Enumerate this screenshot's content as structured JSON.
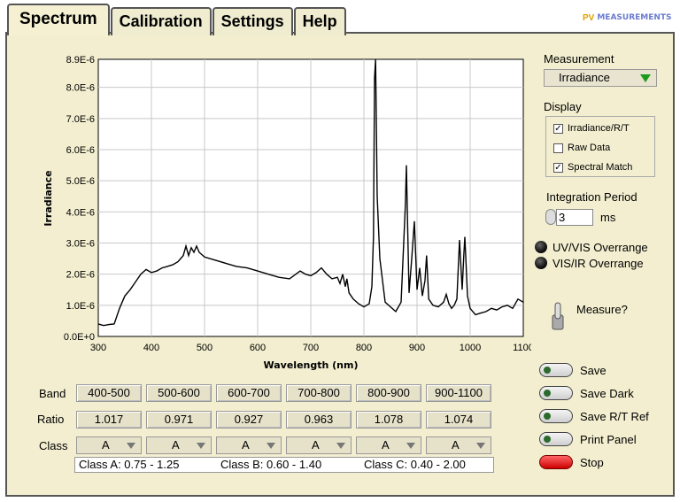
{
  "tabs": [
    {
      "label": "Spectrum",
      "active": true
    },
    {
      "label": "Calibration",
      "active": false
    },
    {
      "label": "Settings",
      "active": false
    },
    {
      "label": "Help",
      "active": false
    }
  ],
  "logo": {
    "mark": "PV",
    "text": "MEASUREMENTS"
  },
  "measurement": {
    "title": "Measurement",
    "selected": "Irradiance"
  },
  "display": {
    "title": "Display",
    "options": [
      {
        "label": "Irradiance/R/T",
        "checked": true
      },
      {
        "label": "Raw Data",
        "checked": false
      },
      {
        "label": "Spectral Match",
        "checked": true
      }
    ]
  },
  "integration": {
    "title": "Integration Period",
    "value": "3",
    "unit": "ms"
  },
  "indicators": {
    "uv_vis": "UV/VIS Overrange",
    "vis_ir": "VIS/IR Overrange"
  },
  "measure_toggle": {
    "label": "Measure?"
  },
  "buttons": {
    "save": "Save",
    "save_dark": "Save Dark",
    "save_rt_ref": "Save R/T Ref",
    "print_panel": "Print Panel",
    "stop": "Stop"
  },
  "table": {
    "band_label": "Band",
    "ratio_label": "Ratio",
    "class_label": "Class",
    "bands": [
      "400-500",
      "500-600",
      "600-700",
      "700-800",
      "800-900",
      "900-1100"
    ],
    "ratios": [
      "1.017",
      "0.971",
      "0.927",
      "0.963",
      "1.078",
      "1.074"
    ],
    "classes": [
      "A",
      "A",
      "A",
      "A",
      "A",
      "A"
    ],
    "legend": {
      "a": "Class A:  0.75 - 1.25",
      "b": "Class B:  0.60 - 1.40",
      "c": "Class C:  0.40 - 2.00"
    }
  },
  "chart_data": {
    "type": "line",
    "xlabel": "Wavelength (nm)",
    "ylabel": "Irradiance",
    "xlim": [
      300,
      1100
    ],
    "ylim": [
      0,
      8.9e-06
    ],
    "xticks": [
      "300",
      "400",
      "500",
      "600",
      "700",
      "800",
      "900",
      "1000",
      "1100"
    ],
    "yticks": [
      "0.0E+0",
      "1.0E-6",
      "2.0E-6",
      "3.0E-6",
      "4.0E-6",
      "5.0E-6",
      "6.0E-6",
      "7.0E-6",
      "8.0E-6",
      "8.9E-6"
    ],
    "grid": true,
    "color": "#000000",
    "series": [
      {
        "x": [
          300,
          310,
          320,
          330,
          340,
          350,
          360,
          370,
          380,
          390,
          400,
          410,
          420,
          430,
          440,
          450,
          460,
          465,
          470,
          475,
          480,
          485,
          490,
          500,
          520,
          540,
          560,
          580,
          600,
          620,
          640,
          660,
          680,
          690,
          700,
          710,
          720,
          730,
          740,
          750,
          755,
          760,
          765,
          768,
          772,
          780,
          790,
          800,
          810,
          815,
          818,
          820,
          822,
          825,
          830,
          835,
          840,
          850,
          860,
          870,
          878,
          880,
          882,
          885,
          890,
          895,
          900,
          905,
          910,
          915,
          918,
          922,
          930,
          940,
          950,
          955,
          960,
          965,
          970,
          975,
          980,
          985,
          988,
          990,
          995,
          1000,
          1005,
          1010,
          1020,
          1030,
          1040,
          1050,
          1060,
          1070,
          1080,
          1090,
          1100
        ],
        "y": [
          4e-07,
          3.5e-07,
          3.8e-07,
          4e-07,
          9e-07,
          1.3e-06,
          1.5e-06,
          1.75e-06,
          2e-06,
          2.15e-06,
          2.05e-06,
          2.1e-06,
          2.2e-06,
          2.25e-06,
          2.3e-06,
          2.4e-06,
          2.6e-06,
          2.9e-06,
          2.6e-06,
          2.85e-06,
          2.7e-06,
          2.9e-06,
          2.7e-06,
          2.55e-06,
          2.45e-06,
          2.35e-06,
          2.25e-06,
          2.2e-06,
          2.1e-06,
          2e-06,
          1.9e-06,
          1.85e-06,
          2.1e-06,
          2e-06,
          1.95e-06,
          2.05e-06,
          2.2e-06,
          2e-06,
          1.85e-06,
          1.9e-06,
          1.7e-06,
          2e-06,
          1.6e-06,
          1.85e-06,
          1.4e-06,
          1.2e-06,
          1.05e-06,
          9.5e-07,
          1.05e-06,
          1.6e-06,
          3.2e-06,
          8.3e-06,
          8.9e-06,
          4.5e-06,
          2.5e-06,
          1.8e-06,
          1.1e-06,
          9.5e-07,
          8e-07,
          1.1e-06,
          4.2e-06,
          5.5e-06,
          3.8e-06,
          1.4e-06,
          2.5e-06,
          3.7e-06,
          1.5e-06,
          2.2e-06,
          1.3e-06,
          1.8e-06,
          2.6e-06,
          1.2e-06,
          1e-06,
          9.5e-07,
          1.1e-06,
          1.35e-06,
          1.05e-06,
          9e-07,
          1e-06,
          1.2e-06,
          3.1e-06,
          1.5e-06,
          2.6e-06,
          3.2e-06,
          1.3e-06,
          9e-07,
          8e-07,
          7e-07,
          7.5e-07,
          8e-07,
          9e-07,
          8.5e-07,
          9.5e-07,
          1e-06,
          9e-07,
          1.2e-06,
          1.1e-06
        ]
      }
    ]
  }
}
